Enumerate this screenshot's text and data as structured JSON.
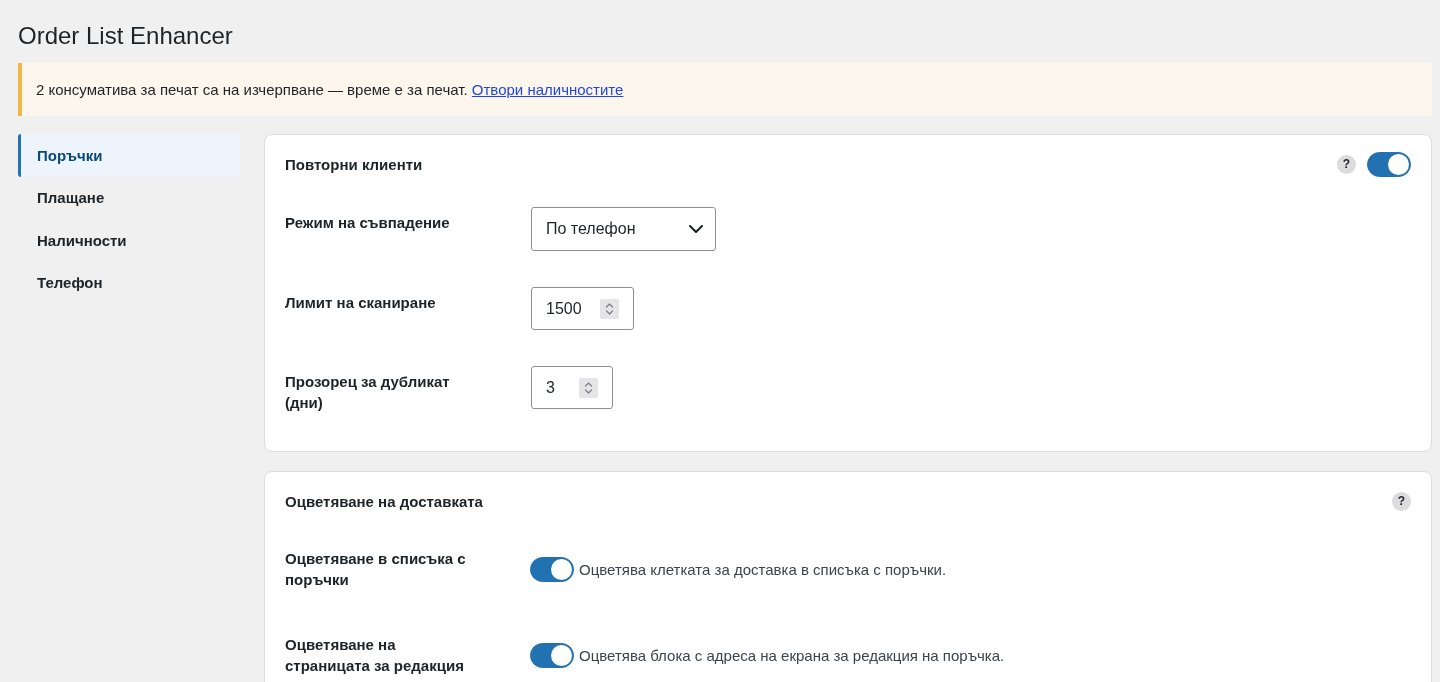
{
  "page": {
    "title": "Order List Enhancer"
  },
  "notice": {
    "text": "2 консуматива за печат са на изчерпване — време е за печат.",
    "link": "Отвори наличностите"
  },
  "sidebar": {
    "items": [
      {
        "label": "Поръчки",
        "selected": true
      },
      {
        "label": "Плащане",
        "selected": false
      },
      {
        "label": "Наличности",
        "selected": false
      },
      {
        "label": "Телефон",
        "selected": false
      }
    ]
  },
  "sections": [
    {
      "title": "Повторни клиенти",
      "help": "?",
      "toggle": {
        "on": true
      },
      "fields": [
        {
          "kind": "select",
          "label": "Режим на съвпадение",
          "value": "По телефон"
        },
        {
          "kind": "number",
          "label": "Лимит на сканиране",
          "value": "1500"
        },
        {
          "kind": "number",
          "label": "Прозорец за дубликат (дни)",
          "value": "3"
        }
      ]
    },
    {
      "title": "Оцветяване на доставката",
      "help": "?",
      "fields": [
        {
          "kind": "toggle",
          "label": "Оцветяване в списъка с поръчки",
          "on": true,
          "description": "Оцветява клетката за доставка в списъка с поръчки."
        },
        {
          "kind": "toggle",
          "label": "Оцветяване на страницата за редакция",
          "on": true,
          "description": "Оцветява блока с адреса на екрана за редакция на поръчка."
        }
      ]
    }
  ]
}
